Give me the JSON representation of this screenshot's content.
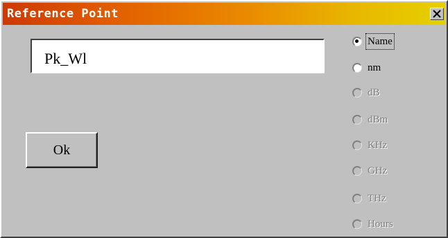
{
  "dialog": {
    "title": "Reference Point",
    "close_icon": "close-x-icon"
  },
  "name_field": {
    "value": "Pk_Wl"
  },
  "ok_button": {
    "label": "Ok"
  },
  "unit_options": [
    {
      "label": "Name",
      "selected": true,
      "enabled": true
    },
    {
      "label": "nm",
      "selected": false,
      "enabled": true
    },
    {
      "label": "dB",
      "selected": false,
      "enabled": false
    },
    {
      "label": "dBm",
      "selected": false,
      "enabled": false
    },
    {
      "label": "KHz",
      "selected": false,
      "enabled": false
    },
    {
      "label": "GHz",
      "selected": false,
      "enabled": false
    },
    {
      "label": "THz",
      "selected": false,
      "enabled": false
    },
    {
      "label": "Hours",
      "selected": false,
      "enabled": false
    }
  ]
}
